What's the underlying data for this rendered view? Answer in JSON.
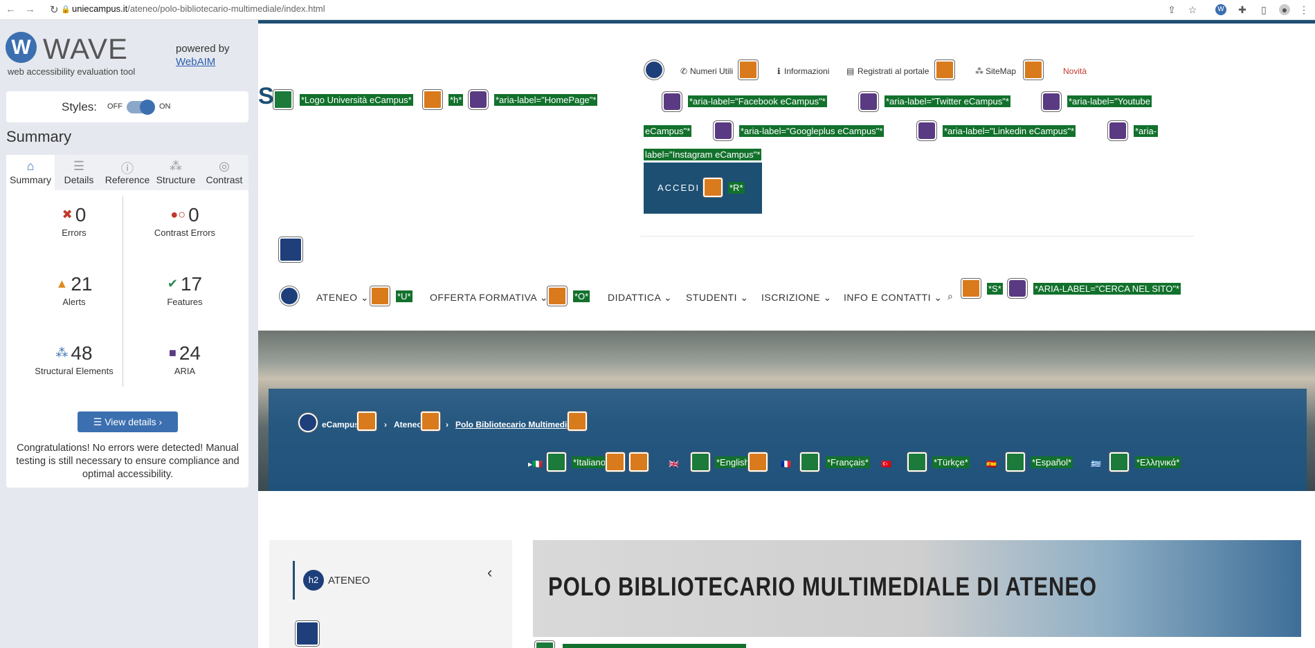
{
  "browser": {
    "url_host": "uniecampus.it",
    "url_path": "/ateneo/polo-bibliotecario-multimediale/index.html"
  },
  "wave": {
    "word": "WAVE",
    "subtitle": "web accessibility evaluation tool",
    "powered_by": "powered by",
    "webaim": "WebAIM",
    "styles_label": "Styles:",
    "styles_off": "OFF",
    "styles_on": "ON",
    "summary_title": "Summary",
    "tabs": [
      {
        "label": "Summary",
        "icon": "home-icon"
      },
      {
        "label": "Details",
        "icon": "list-icon"
      },
      {
        "label": "Reference",
        "icon": "info-icon"
      },
      {
        "label": "Structure",
        "icon": "structure-icon"
      },
      {
        "label": "Contrast",
        "icon": "contrast-icon"
      }
    ],
    "stats": {
      "errors": {
        "value": "0",
        "label": "Errors",
        "color": "#c0392b"
      },
      "contrast": {
        "value": "0",
        "label": "Contrast Errors",
        "color": "#c0392b"
      },
      "alerts": {
        "value": "21",
        "label": "Alerts",
        "color": "#e08a1e"
      },
      "features": {
        "value": "17",
        "label": "Features",
        "color": "#2e8b57"
      },
      "structural": {
        "value": "48",
        "label": "Structural Elements",
        "color": "#3b6fb0"
      },
      "aria": {
        "value": "24",
        "label": "ARIA",
        "color": "#5a3a82"
      }
    },
    "view_details": "View details ›",
    "congrats": "Congratulations! No errors were detected! Manual testing is still necessary to ensure compliance and optimal accessibility."
  },
  "site": {
    "logo_letter": "S",
    "logo_tags": [
      "*Logo Università eCampus*",
      "*h*",
      "*aria-label=\"HomePage\"*"
    ],
    "toplinks": [
      "Numeri Utili",
      "Informazioni",
      "Registrati al portale",
      "SiteMap",
      "Novità"
    ],
    "social_tags": [
      "*aria-label=\"Facebook eCampus\"*",
      "*aria-label=\"Twitter eCampus\"*",
      "*aria-label=\"Youtube",
      "eCampus\"*",
      "*aria-label=\"Googleplus eCampus\"*",
      "*aria-label=\"Linkedin eCampus\"*",
      "*aria-",
      "label=\"Instagram eCampus\"*"
    ],
    "accedi": "ACCEDI",
    "accedi_tag": "*R*",
    "nav": [
      "ATENEO",
      "OFFERTA FORMATIVA",
      "DIDATTICA",
      "STUDENTI",
      "ISCRIZIONE",
      "INFO E CONTATTI"
    ],
    "nav_tags": [
      "*U*",
      "*O*",
      "*S*",
      "*ARIA-LABEL=\"CERCA NEL SITO\"*"
    ],
    "breadcrumb": [
      "eCampus",
      "Ateneo",
      "Polo Bibliotecario Multimediale"
    ],
    "languages": [
      "*Italiano*",
      "*English*",
      "*Français*",
      "*Türkçe*",
      "*Español*",
      "*Ελληνικά*"
    ],
    "side_heading": "ATENEO",
    "side_h2": "h2",
    "banner_title": "POLO BIBLIOTECARIO MULTIMEDIALE DI ATENEO"
  }
}
